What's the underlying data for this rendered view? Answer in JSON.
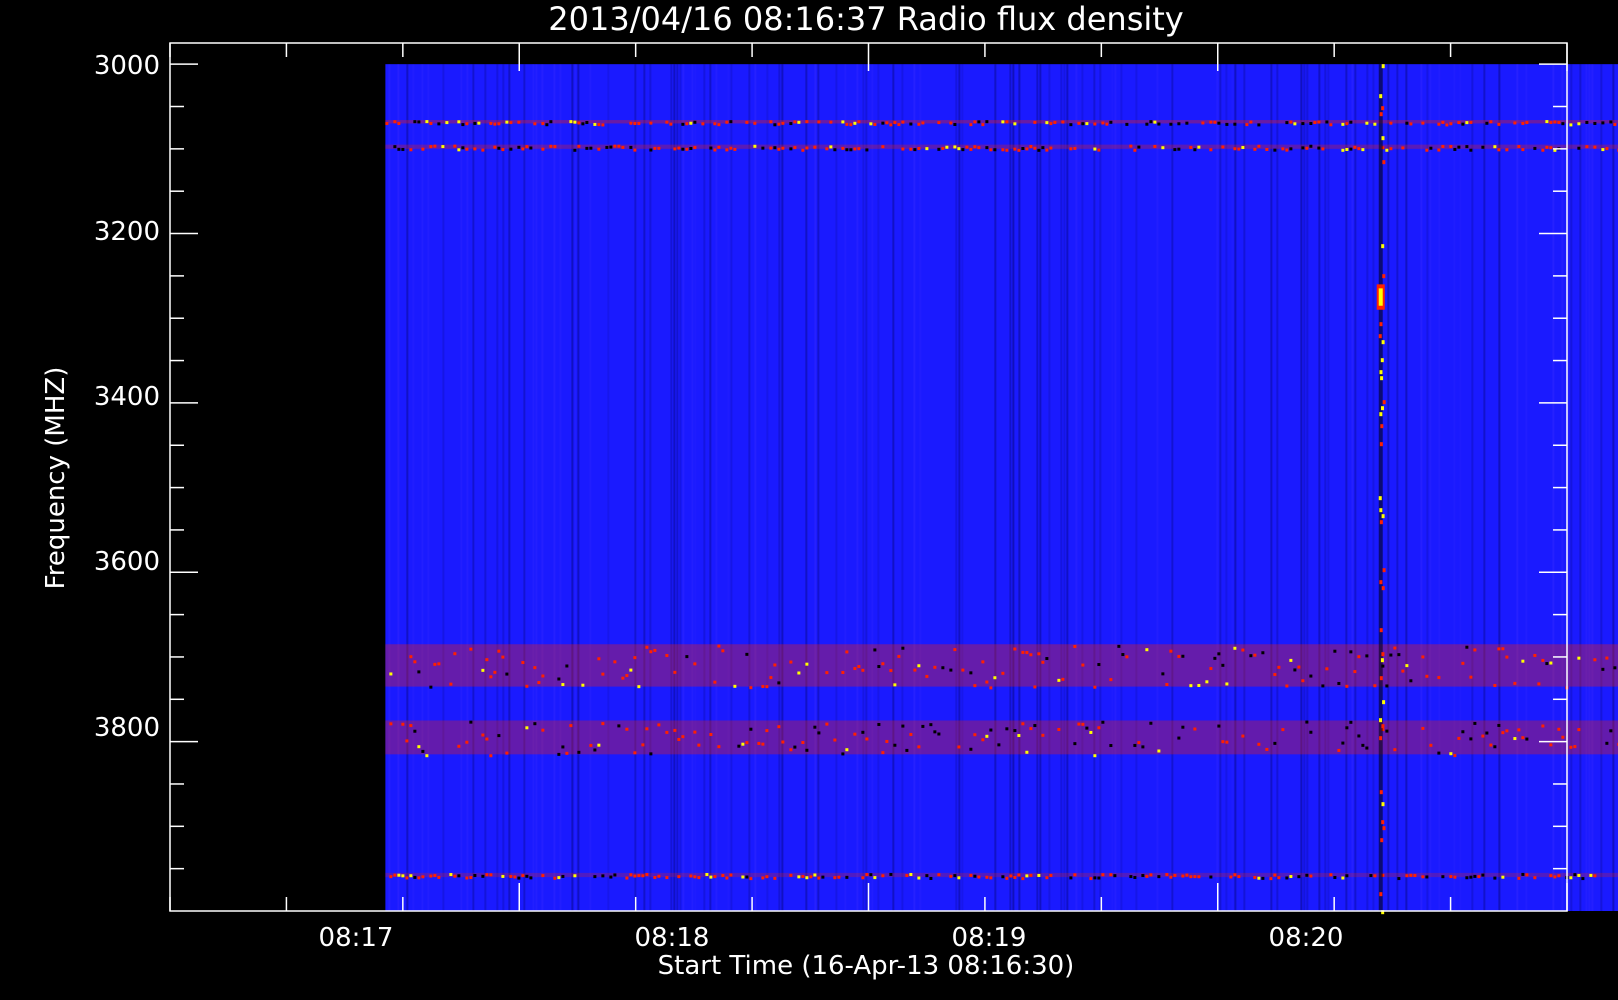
{
  "chart_data": {
    "type": "heatmap",
    "title": "2013/04/16 08:16:37 Radio flux density",
    "xlabel": "Start Time (16-Apr-13 08:16:30)",
    "ylabel": "Frequency (MHZ)",
    "x_ticks": [
      "08:17",
      "08:18",
      "08:19",
      "08:20"
    ],
    "y_ticks": [
      "3000",
      "3200",
      "3400",
      "3600",
      "3800"
    ],
    "x_range_seconds_after_0816": [
      0,
      240
    ],
    "data_x_range_seconds_after_0816": [
      37,
      277
    ],
    "y_range_mhz": [
      2975,
      4000
    ],
    "data_y_range_mhz": [
      3000,
      4000
    ],
    "y_axis_reversed": true,
    "colormap": [
      "#000000",
      "#2020ff",
      "#ff2000",
      "#ffff00"
    ],
    "background": "#1a1aff",
    "features": [
      {
        "kind": "band",
        "freq_mhz": [
          3066,
          3070
        ],
        "level": 1.0
      },
      {
        "kind": "band",
        "freq_mhz": [
          3095,
          3100
        ],
        "level": 0.8
      },
      {
        "kind": "band",
        "freq_mhz": [
          3685,
          3735
        ],
        "level": 0.95
      },
      {
        "kind": "band",
        "freq_mhz": [
          3775,
          3815
        ],
        "level": 0.9
      },
      {
        "kind": "band",
        "freq_mhz": [
          3955,
          3960
        ],
        "level": 0.7
      },
      {
        "kind": "burst",
        "time_s": 208,
        "freq_mhz": [
          3000,
          4000
        ],
        "level": 1.0
      },
      {
        "kind": "hotspot",
        "time_s": 208,
        "freq_mhz": [
          3260,
          3290
        ],
        "level": 1.0
      }
    ]
  }
}
